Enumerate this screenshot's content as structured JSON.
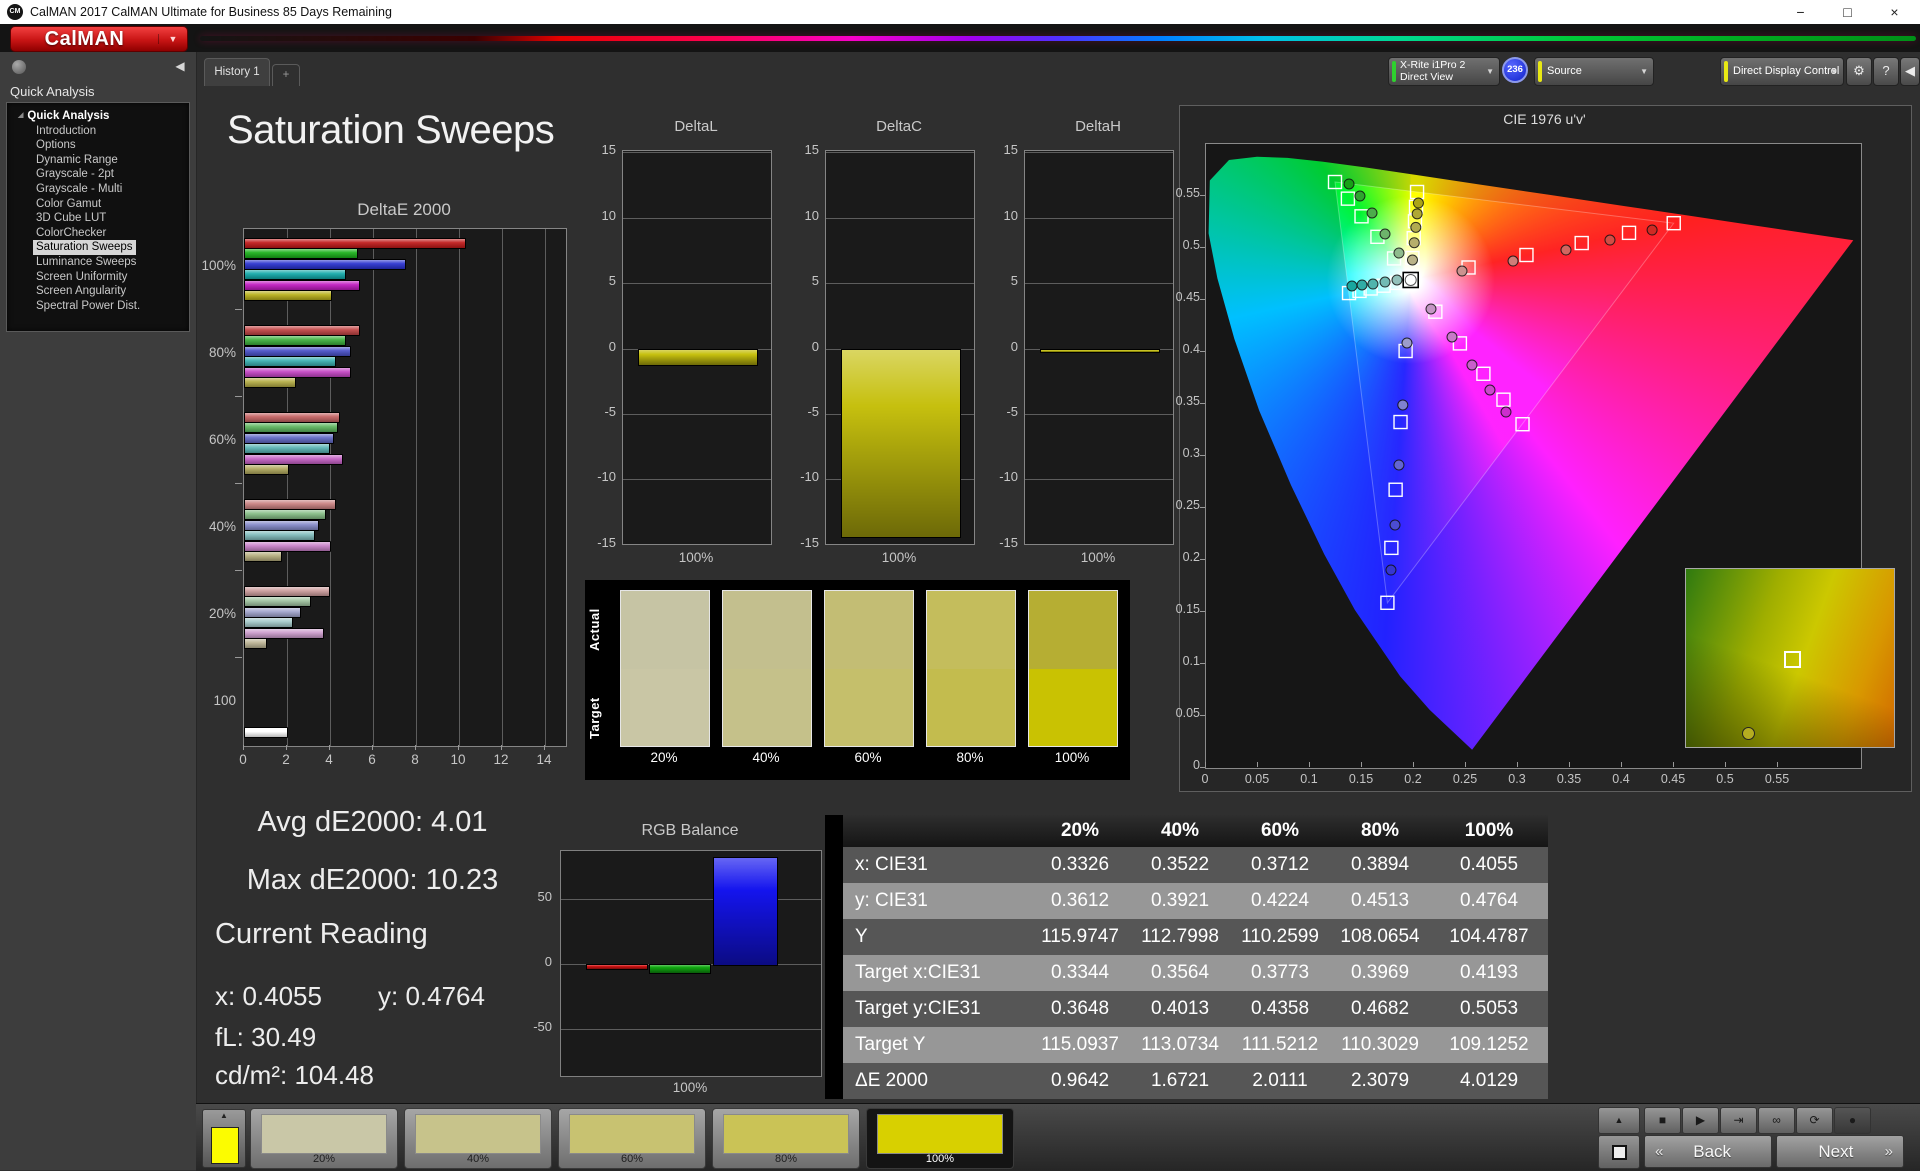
{
  "window": {
    "title": "CalMAN 2017 CalMAN Ultimate for Business 85 Days Remaining",
    "logo_badge": "CM",
    "controls": [
      {
        "name": "minimize",
        "glyph": "−"
      },
      {
        "name": "maximize",
        "glyph": "□"
      },
      {
        "name": "close",
        "glyph": "×"
      }
    ]
  },
  "logo": {
    "text": "CalMAN",
    "color": "#c81414",
    "arrow": "▼"
  },
  "tabs": {
    "history": "History 1",
    "add": "+"
  },
  "sidebar": {
    "header": "Quick Analysis",
    "collapse_icon": "◀",
    "items": [
      {
        "label": "Quick Analysis",
        "root": true
      },
      {
        "label": "Introduction"
      },
      {
        "label": "Options"
      },
      {
        "label": "Dynamic Range"
      },
      {
        "label": "Grayscale - 2pt"
      },
      {
        "label": "Grayscale - Multi"
      },
      {
        "label": "Color Gamut"
      },
      {
        "label": "3D Cube LUT"
      },
      {
        "label": "ColorChecker"
      },
      {
        "label": "Saturation Sweeps",
        "selected": true
      },
      {
        "label": "Luminance Sweeps"
      },
      {
        "label": "Screen Uniformity"
      },
      {
        "label": "Screen Angularity"
      },
      {
        "label": "Spectral Power Dist."
      }
    ]
  },
  "toolbar": {
    "meter": {
      "line1": "X-Rite i1Pro 2",
      "line2": "Direct View",
      "stripe_color": "#2ed22e",
      "arrow": "▼"
    },
    "badge": "236",
    "source": {
      "label": "Source",
      "stripe_color": "#e8e814",
      "arrow": "▼"
    },
    "display_control": {
      "label": "Direct Display Control",
      "stripe_color": "#e8e814",
      "arrow": "▼"
    },
    "gear_icon": "⚙",
    "help_icon": "?",
    "collapse_icon": "◀"
  },
  "page": {
    "title": "Saturation Sweeps"
  },
  "stats": {
    "avg": "Avg dE2000: 4.01",
    "max": "Max dE2000: 10.23",
    "current_title": "Current Reading",
    "x": "x: 0.4055",
    "y": "y: 0.4764",
    "fl": "fL: 30.49",
    "cd": "cd/m²: 104.48"
  },
  "swatch_panel": {
    "row_labels": [
      "Actual",
      "Target"
    ],
    "columns": [
      {
        "label": "20%",
        "actual": "#c6c4a4",
        "target": "#c9c6a5"
      },
      {
        "label": "40%",
        "actual": "#c3bf8e",
        "target": "#c5c18a"
      },
      {
        "label": "60%",
        "actual": "#c3bd74",
        "target": "#c5bf6b"
      },
      {
        "label": "80%",
        "actual": "#c4bd5c",
        "target": "#c3bc4e"
      },
      {
        "label": "100%",
        "actual": "#b6ae33",
        "target": "#c9c202"
      }
    ]
  },
  "table": {
    "headers": [
      "",
      "20%",
      "40%",
      "60%",
      "80%",
      "100%"
    ],
    "rows": [
      {
        "label": "x: CIE31",
        "values": [
          "0.3326",
          "0.3522",
          "0.3712",
          "0.3894",
          "0.4055"
        ]
      },
      {
        "label": "y: CIE31",
        "values": [
          "0.3612",
          "0.3921",
          "0.4224",
          "0.4513",
          "0.4764"
        ]
      },
      {
        "label": "Y",
        "values": [
          "115.9747",
          "112.7998",
          "110.2599",
          "108.0654",
          "104.4787"
        ]
      },
      {
        "label": "Target x:CIE31",
        "values": [
          "0.3344",
          "0.3564",
          "0.3773",
          "0.3969",
          "0.4193"
        ]
      },
      {
        "label": "Target y:CIE31",
        "values": [
          "0.3648",
          "0.4013",
          "0.4358",
          "0.4682",
          "0.5053"
        ]
      },
      {
        "label": "Target Y",
        "values": [
          "115.0937",
          "113.0734",
          "111.5212",
          "110.3029",
          "109.1252"
        ]
      },
      {
        "label": "ΔE 2000",
        "values": [
          "0.9642",
          "1.6721",
          "2.0111",
          "2.3079",
          "4.0129"
        ]
      }
    ]
  },
  "bottom_bar": {
    "preview_color": "#fcfc00",
    "up_icon": "▲",
    "swatches": [
      {
        "label": "20%",
        "color": "#c9c7a7"
      },
      {
        "label": "40%",
        "color": "#c7c38b"
      },
      {
        "label": "60%",
        "color": "#c8c271"
      },
      {
        "label": "80%",
        "color": "#cac356"
      },
      {
        "label": "100%",
        "color": "#d8d000",
        "selected": true
      }
    ],
    "transport": [
      {
        "name": "stop",
        "glyph": "■"
      },
      {
        "name": "play",
        "glyph": "▶"
      },
      {
        "name": "step",
        "glyph": "⇥"
      },
      {
        "name": "loop",
        "glyph": "∞"
      },
      {
        "name": "refresh",
        "glyph": "⟳"
      },
      {
        "name": "record",
        "glyph": "●"
      }
    ],
    "back_chevron": "«",
    "back_label": "Back",
    "next_label": "Next",
    "next_chevron": "»"
  },
  "chart_data": [
    {
      "type": "bar",
      "title": "DeltaE 2000",
      "orientation": "horizontal",
      "xlim": [
        0,
        14
      ],
      "x_ticks": [
        0,
        2,
        4,
        6,
        8,
        10,
        12,
        14
      ],
      "group_labels": [
        "100%",
        "80%",
        "60%",
        "40%",
        "20%",
        "100"
      ],
      "series": [
        "Red",
        "Green",
        "Blue",
        "Cyan",
        "Magenta",
        "Yellow"
      ],
      "values": [
        [
          10.23,
          5.2,
          7.45,
          4.67,
          5.3,
          4.01
        ],
        [
          5.3,
          4.65,
          4.9,
          4.2,
          4.9,
          2.31
        ],
        [
          4.35,
          4.3,
          4.1,
          3.9,
          4.5,
          2.01
        ],
        [
          4.2,
          3.7,
          3.4,
          3.2,
          3.95,
          1.67
        ],
        [
          3.9,
          3.0,
          2.57,
          2.2,
          3.65,
          0.96
        ],
        [
          1.95
        ]
      ],
      "colors": [
        [
          "#c01818",
          "#18b018",
          "#2830d0",
          "#10a8a8",
          "#c018c0",
          "#b8b018"
        ],
        [
          "#c24444",
          "#3cb03c",
          "#4850c8",
          "#38b0b0",
          "#c444c4",
          "#b4ac44"
        ],
        [
          "#c46060",
          "#5cb45c",
          "#6068c4",
          "#58b4b4",
          "#c460c4",
          "#b0a85c"
        ],
        [
          "#c88080",
          "#84bc84",
          "#8489c8",
          "#80bcbc",
          "#c880c8",
          "#b4ac7c"
        ],
        [
          "#cc9c9c",
          "#a0c4a0",
          "#a0a4cc",
          "#a4c8c8",
          "#cc9ccc",
          "#bcb494"
        ],
        [
          "#ffffff"
        ]
      ]
    },
    {
      "type": "bar",
      "title": "DeltaL",
      "xlabel": "100%",
      "ylim": [
        -15,
        15
      ],
      "y_ticks": [
        15,
        10,
        5,
        0,
        -5,
        -10,
        -15
      ],
      "values": [
        -1.2
      ],
      "bar_color": "#c6c00e"
    },
    {
      "type": "bar",
      "title": "DeltaC",
      "xlabel": "100%",
      "ylim": [
        -15,
        15
      ],
      "y_ticks": [
        15,
        10,
        5,
        0,
        -5,
        -10,
        -15
      ],
      "values": [
        -14.3
      ],
      "bar_color": "#c6c00e"
    },
    {
      "type": "bar",
      "title": "DeltaH",
      "xlabel": "100%",
      "ylim": [
        -15,
        15
      ],
      "y_ticks": [
        15,
        10,
        5,
        0,
        -5,
        -10,
        -15
      ],
      "values": [
        -0.15
      ],
      "bar_color": "#c6c00e"
    },
    {
      "type": "scatter",
      "title": "CIE 1976 u'v'",
      "x_ticks": [
        "0",
        "0.05",
        "0.1",
        "0.15",
        "0.2",
        "0.25",
        "0.3",
        "0.35",
        "0.4",
        "0.45",
        "0.5",
        "0.55"
      ],
      "y_ticks": [
        "0",
        "0.05",
        "0.1",
        "0.15",
        "0.2",
        "0.25",
        "0.3",
        "0.35",
        "0.4",
        "0.45",
        "0.5",
        "0.55"
      ],
      "locus": [
        [
          0.2568,
          0.0165
        ],
        [
          0.2161,
          0.0549
        ],
        [
          0.1877,
          0.0871
        ],
        [
          0.1441,
          0.151
        ],
        [
          0.1147,
          0.2044
        ],
        [
          0.0828,
          0.2708
        ],
        [
          0.0521,
          0.3427
        ],
        [
          0.0282,
          0.4117
        ],
        [
          0.0119,
          0.4698
        ],
        [
          0.0035,
          0.5131
        ],
        [
          0.0046,
          0.5639
        ],
        [
          0.0231,
          0.5837
        ],
        [
          0.05,
          0.5867
        ],
        [
          0.0792,
          0.5857
        ],
        [
          0.1127,
          0.5821
        ],
        [
          0.1531,
          0.5766
        ],
        [
          0.2026,
          0.5693
        ],
        [
          0.2623,
          0.5604
        ],
        [
          0.3315,
          0.5501
        ],
        [
          0.4035,
          0.5393
        ],
        [
          0.4692,
          0.5296
        ],
        [
          0.5203,
          0.5219
        ],
        [
          0.583,
          0.5125
        ],
        [
          0.6234,
          0.5065
        ]
      ],
      "gamut_triangle": [
        [
          0.4507,
          0.5229
        ],
        [
          0.125,
          0.5625
        ],
        [
          0.1754,
          0.1579
        ]
      ],
      "white_point": [
        0.1978,
        0.4683
      ],
      "sweeps": [
        {
          "name": "red",
          "targets": [
            [
              0.2534,
              0.4803
            ],
            [
              0.3091,
              0.4923
            ],
            [
              0.3622,
              0.5038
            ],
            [
              0.4077,
              0.5136
            ],
            [
              0.4507,
              0.5229
            ]
          ],
          "measured": [
            [
              0.2471,
              0.4769
            ],
            [
              0.2962,
              0.4865
            ],
            [
              0.3471,
              0.4971
            ],
            [
              0.3894,
              0.5067
            ],
            [
              0.4299,
              0.5163
            ]
          ],
          "colors": [
            "#cb938f",
            "#cf7d78",
            "#d16660",
            "#d24c45",
            "#d02a24"
          ]
        },
        {
          "name": "green",
          "targets": [
            [
              0.1818,
              0.489
            ],
            [
              0.1658,
              0.5098
            ],
            [
              0.1505,
              0.5295
            ],
            [
              0.1374,
              0.5465
            ],
            [
              0.125,
              0.5625
            ]
          ],
          "measured": [
            [
              0.1865,
              0.4942
            ],
            [
              0.1731,
              0.5125
            ],
            [
              0.1606,
              0.5327
            ],
            [
              0.149,
              0.549
            ],
            [
              0.1385,
              0.5606
            ]
          ],
          "colors": [
            "#8fbc8d",
            "#6db46b",
            "#4cac4b",
            "#2ea42f",
            "#17a017"
          ]
        },
        {
          "name": "blue",
          "targets": [
            [
              0.1929,
              0.4
            ],
            [
              0.188,
              0.3317
            ],
            [
              0.1833,
              0.2666
            ],
            [
              0.1792,
              0.2107
            ],
            [
              0.1754,
              0.1579
            ]
          ],
          "measured": [
            [
              0.1942,
              0.4077
            ],
            [
              0.1902,
              0.3481
            ],
            [
              0.1865,
              0.2904
            ],
            [
              0.1827,
              0.2327
            ],
            [
              0.1788,
              0.1894
            ]
          ],
          "colors": [
            "#9c9dcb",
            "#8081cf",
            "#6365d2",
            "#4b4cd2",
            "#3636d0"
          ]
        },
        {
          "name": "cyan",
          "targets": [
            [
              0.1848,
              0.4655
            ],
            [
              0.1717,
              0.4628
            ],
            [
              0.1593,
              0.4601
            ],
            [
              0.1486,
              0.4578
            ],
            [
              0.1385,
              0.4557
            ]
          ],
          "measured": [
            [
              0.1846,
              0.4683
            ],
            [
              0.1731,
              0.4663
            ],
            [
              0.1615,
              0.4644
            ],
            [
              0.151,
              0.4635
            ],
            [
              0.1413,
              0.4625
            ]
          ],
          "colors": [
            "#93c1bb",
            "#72bbb4",
            "#50b4ad",
            "#30ada6",
            "#18a79f"
          ]
        },
        {
          "name": "magenta",
          "targets": [
            [
              0.2215,
              0.4378
            ],
            [
              0.2451,
              0.4073
            ],
            [
              0.2677,
              0.3781
            ],
            [
              0.287,
              0.3532
            ],
            [
              0.3053,
              0.3296
            ]
          ],
          "measured": [
            [
              0.2173,
              0.4404
            ],
            [
              0.2375,
              0.4135
            ],
            [
              0.2567,
              0.3865
            ],
            [
              0.274,
              0.3625
            ],
            [
              0.2894,
              0.3413
            ]
          ],
          "colors": [
            "#c495c4",
            "#c77ac8",
            "#c95fca",
            "#cb47cc",
            "#cc2ecd"
          ]
        },
        {
          "name": "yellow",
          "targets": [
            [
              0.1994,
              0.4894
            ],
            [
              0.2007,
              0.5085
            ],
            [
              0.2019,
              0.5247
            ],
            [
              0.2029,
              0.5386
            ],
            [
              0.2039,
              0.5529
            ]
          ],
          "measured": [
            [
              0.1995,
              0.4875
            ],
            [
              0.2012,
              0.5041
            ],
            [
              0.2027,
              0.5189
            ],
            [
              0.204,
              0.5319
            ],
            [
              0.2052,
              0.5423
            ]
          ],
          "colors": [
            "#bab388",
            "#b6ae6b",
            "#b2ab4f",
            "#afa834",
            "#aba418"
          ]
        }
      ],
      "inset": {
        "square": [
          0.47,
          0.46
        ],
        "point": [
          0.27,
          0.89
        ],
        "point_color": "#b5ad20"
      }
    },
    {
      "type": "bar",
      "title": "RGB Balance",
      "xlabel": "100%",
      "ylim": [
        -70,
        87
      ],
      "y_ticks": [
        50,
        0,
        -50
      ],
      "categories": [
        "Red",
        "Green",
        "Blue"
      ],
      "values": [
        -3,
        -6,
        82
      ],
      "colors": [
        "#d41414",
        "#10a810",
        "#1414ee"
      ]
    }
  ]
}
